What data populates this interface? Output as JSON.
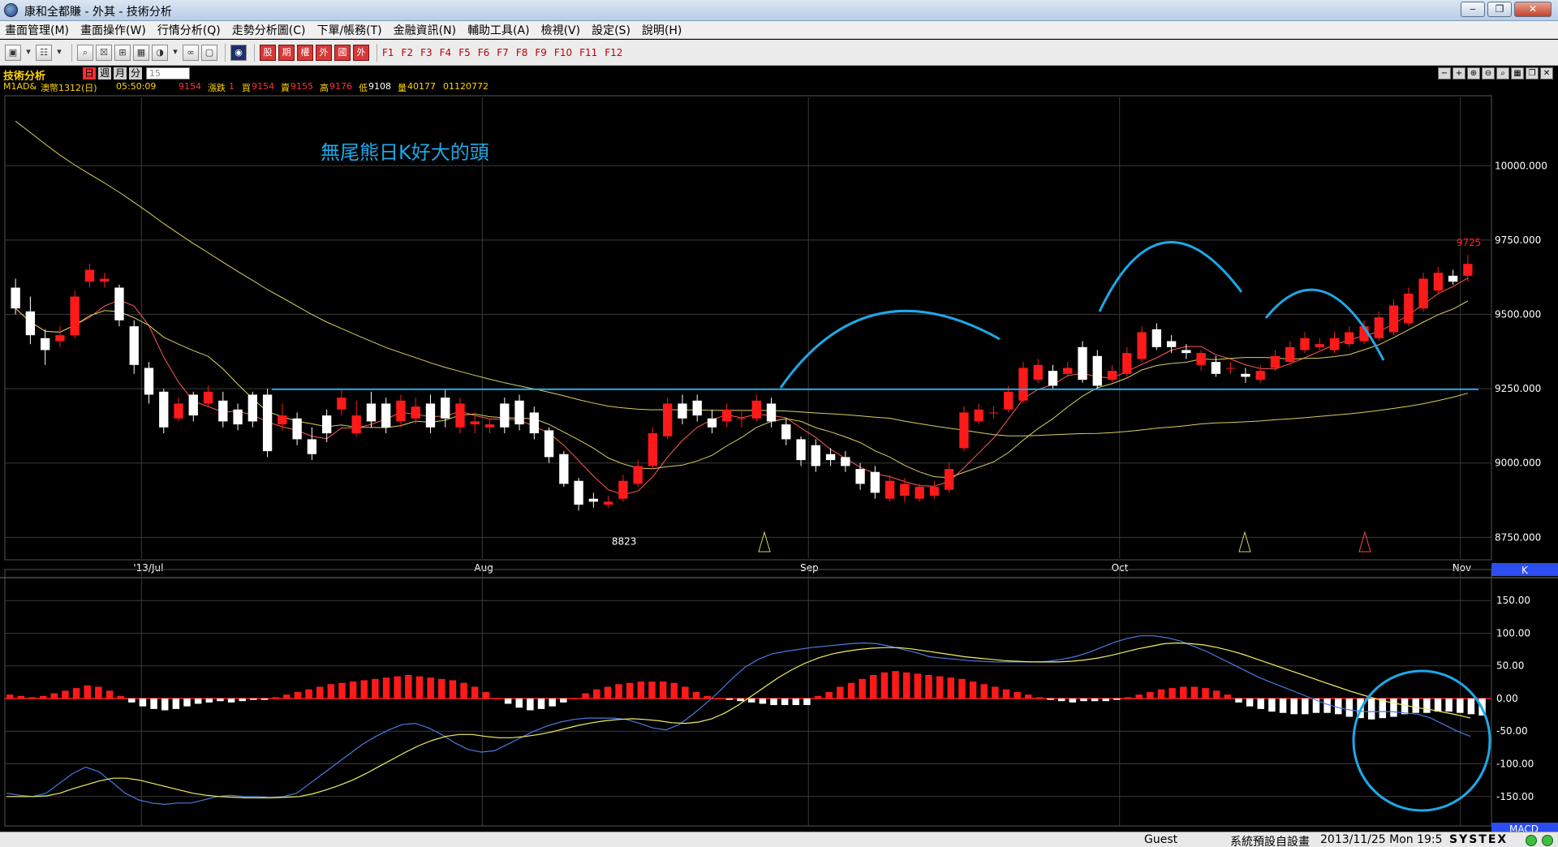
{
  "window": {
    "title": "康和全都賺 - 外其 - 技術分析"
  },
  "menu": [
    "畫面管理(M)",
    "畫面操作(W)",
    "行情分析(Q)",
    "走勢分析圖(C)",
    "下單/帳務(T)",
    "金融資訊(N)",
    "輔助工具(A)",
    "檢視(V)",
    "設定(S)",
    "說明(H)"
  ],
  "toolbar": {
    "icons": [
      "window-icon",
      "dropdown-icon",
      "chart-icon",
      "dropdown-icon",
      "search-icon",
      "close-icon",
      "layout-icon",
      "grid-icon",
      "pie-icon",
      "dropdown-icon",
      "link-icon",
      "window-icon",
      "globe-icon"
    ],
    "red_buttons": [
      "股",
      "期",
      "權",
      "外",
      "國",
      "外"
    ],
    "fkeys": [
      "F1",
      "F2",
      "F3",
      "F4",
      "F5",
      "F6",
      "F7",
      "F8",
      "F9",
      "F10",
      "F11",
      "F12"
    ]
  },
  "panel": {
    "label": "技術分析",
    "periods": [
      "日",
      "週",
      "月",
      "分"
    ],
    "active_period": "日",
    "minute_value": "15"
  },
  "quote": {
    "symbol": "M1AD&",
    "name": "澳幣1312(日)",
    "time": "05:50:09",
    "last": "9154",
    "change_label": "漲跌",
    "change": "1",
    "bid_label": "買",
    "bid": "9154",
    "ask_label": "賣",
    "ask": "9155",
    "high_label": "高",
    "high": "9176",
    "low_label": "低",
    "low": "9108",
    "volume_label": "量",
    "volume": "40177",
    "oi": "01120772"
  },
  "colors": {
    "up": "#ff1a1a",
    "down": "#ffffff",
    "ma_short": "#ff5a5a",
    "ma_mid": "#d8d060",
    "ma_long": "#d8d060",
    "annotation": "#1ea8e8",
    "dif": "#4a7ae0",
    "macd": "#f0f060",
    "grid": "#3a3a3a",
    "axis_text": "#ffffff"
  },
  "annotation_text": "無尾熊日K好大的頭",
  "chart_data": [
    {
      "type": "candlestick",
      "title": "",
      "y_ticks": [
        8750,
        9000,
        9250,
        9500,
        9750,
        10000
      ],
      "y_tick_labels": [
        "8750.000",
        "9000.000",
        "9250.000",
        "9500.000",
        "9750.000",
        "10000.000"
      ],
      "ylim": [
        8680,
        10230
      ],
      "x_labels": [
        {
          "label": "'13/Jul",
          "index": 9
        },
        {
          "label": "Aug",
          "index": 32
        },
        {
          "label": "Sep",
          "index": 54
        },
        {
          "label": "Oct",
          "index": 75
        },
        {
          "label": "Nov",
          "index": 98
        }
      ],
      "panel_tag": "K",
      "low_marker": {
        "label": "8823",
        "index": 41,
        "value": 8823
      },
      "high_marker": {
        "label": "9725",
        "index": 98,
        "value": 9725
      },
      "neckline": 9248,
      "open": [
        9590,
        9510,
        9420,
        9410,
        9430,
        9610,
        9610,
        9590,
        9460,
        9320,
        9240,
        9150,
        9230,
        9200,
        9210,
        9180,
        9230,
        9230,
        9130,
        9150,
        9080,
        9160,
        9180,
        9100,
        9200,
        9200,
        9140,
        9150,
        9200,
        9220,
        9120,
        9130,
        9120,
        9200,
        9210,
        9170,
        9110,
        9030,
        8940,
        8880,
        8860,
        8880,
        8930,
        8990,
        9090,
        9200,
        9210,
        9150,
        9140,
        9150,
        9150,
        9200,
        9130,
        9080,
        9060,
        9030,
        9020,
        8980,
        8970,
        8880,
        8890,
        8880,
        8890,
        8910,
        9050,
        9140,
        9170,
        9180,
        9210,
        9280,
        9310,
        9300,
        9390,
        9360,
        9280,
        9300,
        9350,
        9450,
        9410,
        9380,
        9330,
        9340,
        9320,
        9300,
        9280,
        9320,
        9340,
        9380,
        9390,
        9380,
        9400,
        9410,
        9420,
        9440,
        9470,
        9520,
        9580,
        9630,
        9630
      ],
      "close": [
        9520,
        9430,
        9380,
        9430,
        9560,
        9650,
        9620,
        9480,
        9330,
        9230,
        9120,
        9200,
        9160,
        9240,
        9140,
        9130,
        9140,
        9040,
        9160,
        9080,
        9030,
        9100,
        9220,
        9160,
        9140,
        9120,
        9210,
        9190,
        9120,
        9150,
        9200,
        9140,
        9130,
        9120,
        9130,
        9100,
        9020,
        8930,
        8860,
        8870,
        8870,
        8940,
        8990,
        9100,
        9200,
        9150,
        9160,
        9120,
        9180,
        9150,
        9210,
        9140,
        9080,
        9010,
        8990,
        9010,
        8990,
        8930,
        8900,
        8940,
        8930,
        8920,
        8920,
        8980,
        9170,
        9180,
        9170,
        9240,
        9320,
        9330,
        9260,
        9320,
        9280,
        9260,
        9310,
        9370,
        9440,
        9390,
        9390,
        9370,
        9370,
        9300,
        9320,
        9290,
        9310,
        9360,
        9390,
        9420,
        9400,
        9420,
        9440,
        9460,
        9490,
        9530,
        9570,
        9620,
        9640,
        9610,
        9670
      ],
      "high": [
        9620,
        9560,
        9450,
        9460,
        9580,
        9670,
        9640,
        9600,
        9480,
        9340,
        9250,
        9220,
        9240,
        9260,
        9240,
        9200,
        9240,
        9250,
        9200,
        9170,
        9120,
        9180,
        9250,
        9210,
        9240,
        9220,
        9230,
        9220,
        9230,
        9250,
        9220,
        9170,
        9150,
        9220,
        9230,
        9190,
        9120,
        9040,
        8950,
        8900,
        8890,
        8960,
        9010,
        9120,
        9220,
        9230,
        9230,
        9180,
        9200,
        9180,
        9230,
        9220,
        9150,
        9090,
        9080,
        9050,
        9040,
        9000,
        8990,
        8960,
        8950,
        8930,
        8940,
        9000,
        9190,
        9200,
        9190,
        9260,
        9340,
        9350,
        9330,
        9340,
        9410,
        9380,
        9330,
        9390,
        9460,
        9470,
        9430,
        9400,
        9380,
        9360,
        9340,
        9320,
        9330,
        9380,
        9410,
        9440,
        9420,
        9440,
        9460,
        9480,
        9510,
        9550,
        9590,
        9640,
        9660,
        9650,
        9700
      ],
      "low": [
        9500,
        9400,
        9330,
        9390,
        9420,
        9590,
        9590,
        9460,
        9300,
        9200,
        9100,
        9140,
        9140,
        9190,
        9120,
        9110,
        9120,
        9020,
        9110,
        9060,
        9010,
        9070,
        9160,
        9090,
        9120,
        9100,
        9120,
        9130,
        9100,
        9120,
        9100,
        9100,
        9100,
        9100,
        9110,
        9080,
        9000,
        8920,
        8840,
        8850,
        8850,
        8870,
        8920,
        8980,
        9080,
        9130,
        9140,
        9100,
        9120,
        9120,
        9140,
        9120,
        9060,
        8990,
        8970,
        8990,
        8970,
        8910,
        8880,
        8870,
        8870,
        8870,
        8880,
        8900,
        9040,
        9130,
        9150,
        9170,
        9200,
        9270,
        9250,
        9290,
        9270,
        9250,
        9270,
        9290,
        9340,
        9380,
        9370,
        9350,
        9310,
        9290,
        9300,
        9270,
        9270,
        9310,
        9330,
        9370,
        9380,
        9370,
        9390,
        9400,
        9410,
        9430,
        9460,
        9510,
        9570,
        9600,
        9610
      ]
    },
    {
      "type": "macd",
      "title": "",
      "y_ticks": [
        -150,
        -100,
        -50,
        0,
        50,
        100,
        150
      ],
      "y_tick_labels": [
        "-150.00",
        "-100.00",
        "-50.00",
        "0.00",
        "50.00",
        "100.00",
        "150.00"
      ],
      "ylim": [
        -195,
        190
      ],
      "panel_tag": "MACD",
      "osc": [
        6,
        4,
        2,
        4,
        8,
        12,
        16,
        20,
        18,
        12,
        4,
        -6,
        -12,
        -16,
        -18,
        -16,
        -12,
        -8,
        -6,
        -4,
        -6,
        -4,
        -2,
        -2,
        2,
        6,
        10,
        14,
        18,
        22,
        24,
        26,
        28,
        30,
        32,
        34,
        36,
        34,
        32,
        30,
        28,
        24,
        18,
        10,
        0,
        -8,
        -14,
        -18,
        -16,
        -12,
        -6,
        0,
        8,
        14,
        18,
        22,
        24,
        26,
        26,
        26,
        24,
        18,
        10,
        4,
        0,
        -2,
        -4,
        -6,
        -8,
        -10,
        -10,
        -10,
        -10,
        4,
        10,
        18,
        24,
        30,
        36,
        40,
        42,
        40,
        38,
        36,
        34,
        32,
        30,
        26,
        22,
        18,
        14,
        10,
        6,
        2,
        -2,
        -4,
        -6,
        -4,
        -4,
        -4,
        -2,
        2,
        6,
        10,
        14,
        16,
        18,
        18,
        16,
        12,
        6,
        -6,
        -12,
        -16,
        -20,
        -22,
        -24,
        -24,
        -22,
        -22,
        -24,
        -28,
        -30,
        -32,
        -30,
        -28,
        -24,
        -22,
        -22,
        -20,
        -20,
        -22,
        -24,
        -26
      ],
      "dif": [
        -145,
        -148,
        -150,
        -145,
        -130,
        -115,
        -105,
        -112,
        -128,
        -145,
        -155,
        -160,
        -162,
        -160,
        -160,
        -155,
        -150,
        -148,
        -150,
        -150,
        -152,
        -150,
        -145,
        -130,
        -115,
        -100,
        -85,
        -70,
        -58,
        -48,
        -40,
        -38,
        -45,
        -55,
        -68,
        -78,
        -82,
        -80,
        -70,
        -60,
        -50,
        -42,
        -36,
        -32,
        -30,
        -30,
        -30,
        -32,
        -38,
        -45,
        -48,
        -40,
        -25,
        -8,
        10,
        30,
        48,
        60,
        68,
        72,
        75,
        78,
        80,
        82,
        84,
        85,
        84,
        80,
        75,
        70,
        64,
        62,
        60,
        58,
        57,
        56,
        56,
        56,
        56,
        57,
        60,
        64,
        70,
        78,
        86,
        92,
        96,
        96,
        93,
        88,
        80,
        72,
        62,
        52,
        42,
        32,
        24,
        16,
        8,
        0,
        -8,
        -14,
        -18,
        -20,
        -20,
        -20,
        -22,
        -24,
        -30,
        -40,
        -50,
        -58
      ],
      "macd": [
        -150,
        -150,
        -150,
        -149,
        -145,
        -138,
        -132,
        -126,
        -122,
        -122,
        -125,
        -130,
        -135,
        -140,
        -145,
        -148,
        -150,
        -151,
        -152,
        -152,
        -152,
        -151,
        -150,
        -146,
        -140,
        -133,
        -125,
        -115,
        -104,
        -93,
        -82,
        -72,
        -64,
        -58,
        -55,
        -55,
        -58,
        -60,
        -60,
        -58,
        -55,
        -51,
        -46,
        -41,
        -37,
        -34,
        -32,
        -31,
        -32,
        -34,
        -37,
        -38,
        -36,
        -31,
        -22,
        -10,
        4,
        18,
        32,
        44,
        54,
        62,
        68,
        72,
        75,
        77,
        78,
        78,
        76,
        73,
        70,
        67,
        64,
        62,
        60,
        58,
        57,
        56,
        56,
        56,
        57,
        59,
        62,
        66,
        71,
        76,
        80,
        84,
        85,
        84,
        82,
        78,
        73,
        67,
        60,
        53,
        46,
        39,
        32,
        25,
        18,
        11,
        5,
        -1,
        -6,
        -10,
        -14,
        -17,
        -21,
        -25,
        -30
      ]
    }
  ]
}
